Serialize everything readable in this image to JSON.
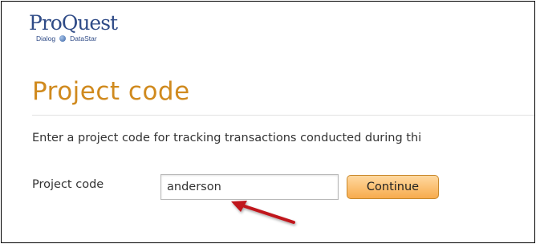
{
  "brand": {
    "name": "ProQuest",
    "sub_left": "Dialog",
    "sub_right": "DataStar",
    "color": "#2f4b87"
  },
  "page": {
    "title": "Project code",
    "description": "Enter a project code for tracking transactions conducted during thi"
  },
  "form": {
    "label": "Project code",
    "value": "anderson",
    "button": "Continue"
  },
  "colors": {
    "title": "#d08a1e",
    "button": "#f7ab4d",
    "arrow": "#c0141b"
  },
  "icons": [
    "logo",
    "annotation-arrow-icon"
  ]
}
